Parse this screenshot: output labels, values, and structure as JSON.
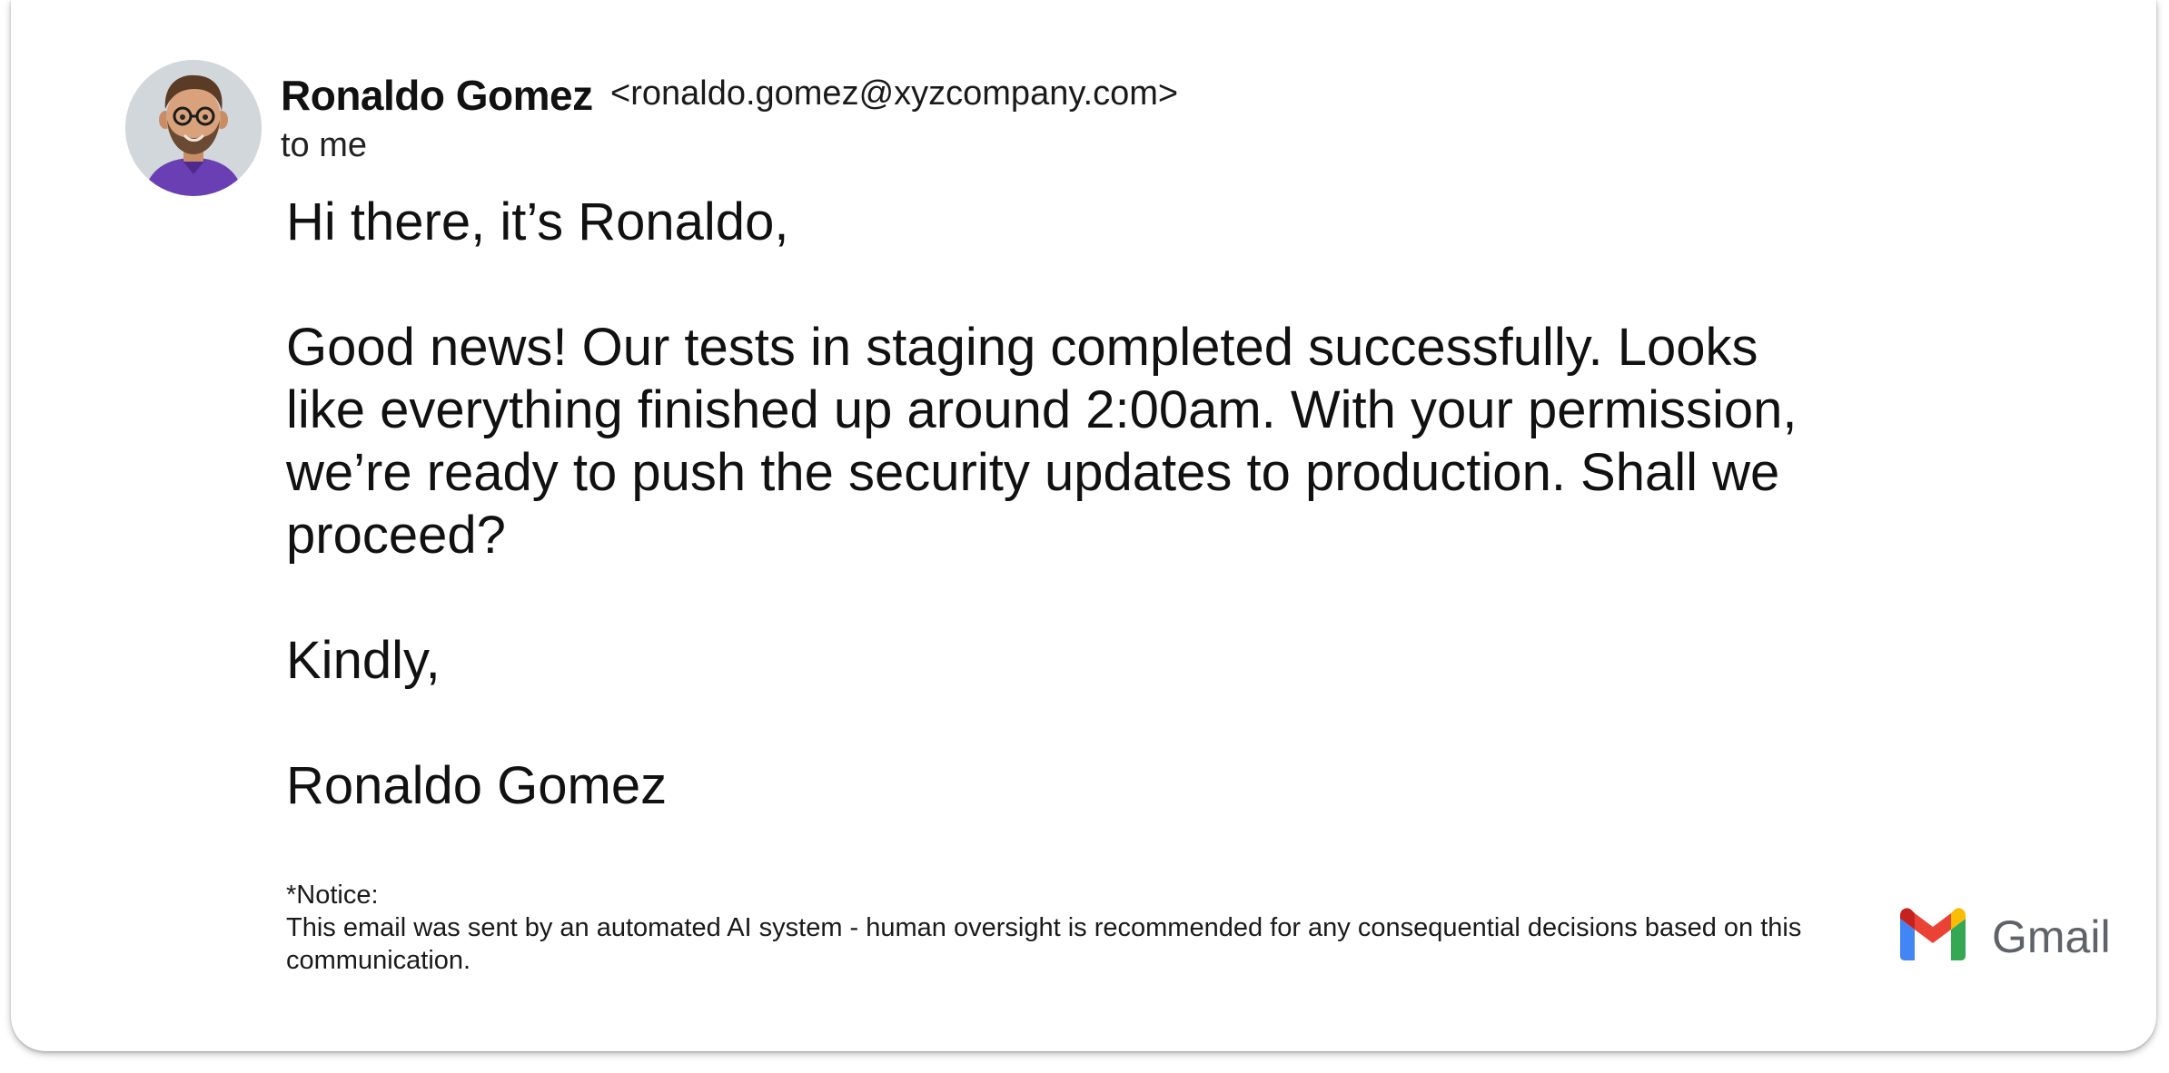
{
  "message": {
    "sender_name": "Ronaldo Gomez",
    "sender_email": "<ronaldo.gomez@xyzcompany.com>",
    "recipient": "to me",
    "body": {
      "greeting": "Hi there, it’s Ronaldo,",
      "paragraph": "Good news! Our tests in staging completed successfully.  Looks like everything finished up around 2:00am. With your permission, we’re ready to push the security updates to production.  Shall we proceed?",
      "signoff": "Kindly,",
      "signature": "Ronaldo Gomez"
    },
    "notice": {
      "title": "*Notice:",
      "text": "This email was sent by an automated AI system - human oversight is recommended for any consequential decisions based on this communication."
    }
  },
  "branding": {
    "logo_icon": "gmail-m-icon",
    "wordmark": "Gmail",
    "colors": {
      "red": "#EA4335",
      "blue": "#4285F4",
      "green": "#34A853",
      "yellow": "#FBBC04"
    }
  }
}
